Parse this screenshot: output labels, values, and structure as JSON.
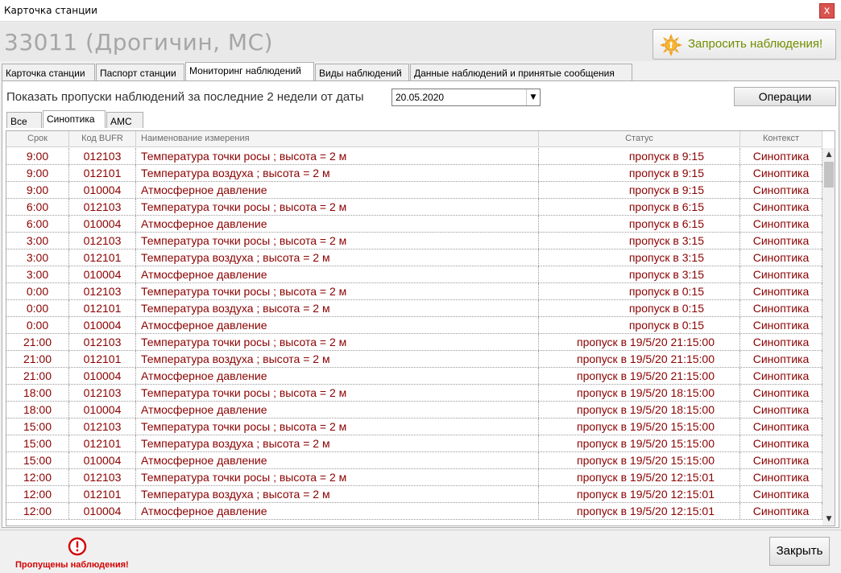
{
  "window": {
    "title": "Карточка станции",
    "close_glyph": "x"
  },
  "header": {
    "station": "33011 (Дрогичин, МС)",
    "request_button": "Запросить наблюдения!"
  },
  "main_tabs": [
    {
      "label": "Карточка станции"
    },
    {
      "label": "Паспорт станции"
    },
    {
      "label": "Мониторинг наблюдений",
      "active": true
    },
    {
      "label": "Виды наблюдений"
    },
    {
      "label": "Данные наблюдений и принятые сообщения"
    }
  ],
  "filter": {
    "label": "Показать пропуски наблюдений за последние 2 недели от даты",
    "date": "20.05.2020",
    "operations": "Операции"
  },
  "sub_tabs": [
    {
      "label": "Все"
    },
    {
      "label": "Синоптика",
      "active": true
    },
    {
      "label": "АМС"
    }
  ],
  "table": {
    "columns": [
      "Срок",
      "Код BUFR",
      "Наименование измерения",
      "Статус",
      "Контекст"
    ],
    "rows": [
      [
        "9:00",
        "012103",
        "Температура точки росы ; высота = 2 м",
        "пропуск в  9:15",
        "Синоптика"
      ],
      [
        "9:00",
        "012101",
        "Температура воздуха ; высота = 2 м",
        "пропуск в  9:15",
        "Синоптика"
      ],
      [
        "9:00",
        "010004",
        "Атмосферное давление",
        "пропуск в  9:15",
        "Синоптика"
      ],
      [
        "6:00",
        "012103",
        "Температура точки росы ; высота = 2 м",
        "пропуск в  6:15",
        "Синоптика"
      ],
      [
        "6:00",
        "010004",
        "Атмосферное давление",
        "пропуск в  6:15",
        "Синоптика"
      ],
      [
        "3:00",
        "012103",
        "Температура точки росы ; высота = 2 м",
        "пропуск в  3:15",
        "Синоптика"
      ],
      [
        "3:00",
        "012101",
        "Температура воздуха ; высота = 2 м",
        "пропуск в  3:15",
        "Синоптика"
      ],
      [
        "3:00",
        "010004",
        "Атмосферное давление",
        "пропуск в  3:15",
        "Синоптика"
      ],
      [
        "0:00",
        "012103",
        "Температура точки росы ; высота = 2 м",
        "пропуск в  0:15",
        "Синоптика"
      ],
      [
        "0:00",
        "012101",
        "Температура воздуха ; высота = 2 м",
        "пропуск в  0:15",
        "Синоптика"
      ],
      [
        "0:00",
        "010004",
        "Атмосферное давление",
        "пропуск в  0:15",
        "Синоптика"
      ],
      [
        "21:00",
        "012103",
        "Температура точки росы ; высота = 2 м",
        "пропуск в 19/5/20 21:15:00",
        "Синоптика"
      ],
      [
        "21:00",
        "012101",
        "Температура воздуха ; высота = 2 м",
        "пропуск в 19/5/20 21:15:00",
        "Синоптика"
      ],
      [
        "21:00",
        "010004",
        "Атмосферное давление",
        "пропуск в 19/5/20 21:15:00",
        "Синоптика"
      ],
      [
        "18:00",
        "012103",
        "Температура точки росы ; высота = 2 м",
        "пропуск в 19/5/20 18:15:00",
        "Синоптика"
      ],
      [
        "18:00",
        "010004",
        "Атмосферное давление",
        "пропуск в 19/5/20 18:15:00",
        "Синоптика"
      ],
      [
        "15:00",
        "012103",
        "Температура точки росы ; высота = 2 м",
        "пропуск в 19/5/20 15:15:00",
        "Синоптика"
      ],
      [
        "15:00",
        "012101",
        "Температура воздуха ; высота = 2 м",
        "пропуск в 19/5/20 15:15:00",
        "Синоптика"
      ],
      [
        "15:00",
        "010004",
        "Атмосферное давление",
        "пропуск в 19/5/20 15:15:00",
        "Синоптика"
      ],
      [
        "12:00",
        "012103",
        "Температура точки росы ; высота = 2 м",
        "пропуск в 19/5/20 12:15:01",
        "Синоптика"
      ],
      [
        "12:00",
        "012101",
        "Температура воздуха ; высота = 2 м",
        "пропуск в 19/5/20 12:15:01",
        "Синоптика"
      ],
      [
        "12:00",
        "010004",
        "Атмосферное давление",
        "пропуск в 19/5/20 12:15:01",
        "Синоптика"
      ]
    ]
  },
  "footer": {
    "warning": "Пропущены наблюдения!",
    "close": "Закрыть"
  },
  "colors": {
    "row_text": "#8b0000",
    "warning": "#d40000",
    "request_text": "#6f8f00"
  },
  "icons": {
    "request": "sun-icon",
    "warning": "alert-circle-icon"
  }
}
